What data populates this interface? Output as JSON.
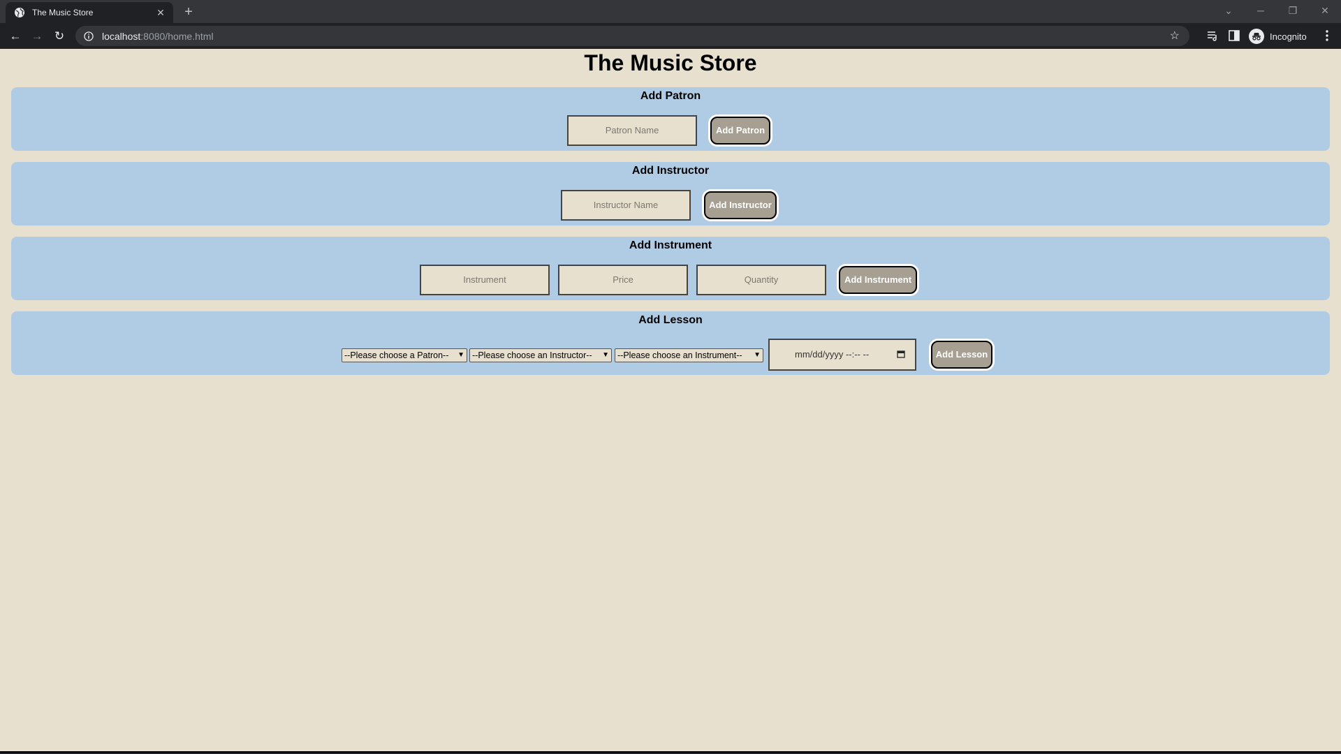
{
  "browser": {
    "tab_title": "The Music Store",
    "url_host": "localhost",
    "url_rest": ":8080/home.html",
    "profile_label": "Incognito"
  },
  "page": {
    "title": "The Music Store",
    "add_patron": {
      "heading": "Add Patron",
      "name_placeholder": "Patron Name",
      "button": "Add Patron"
    },
    "add_instructor": {
      "heading": "Add Instructor",
      "name_placeholder": "Instructor Name",
      "button": "Add Instructor"
    },
    "add_instrument": {
      "heading": "Add Instrument",
      "instrument_placeholder": "Instrument",
      "price_placeholder": "Price",
      "quantity_placeholder": "Quantity",
      "button": "Add Instrument"
    },
    "add_lesson": {
      "heading": "Add Lesson",
      "patron_select": "--Please choose a Patron--",
      "instructor_select": "--Please choose an Instructor--",
      "instrument_select": "--Please choose an Instrument--",
      "datetime_placeholder": "mm/dd/yyyy --:-- --",
      "button": "Add Lesson"
    }
  },
  "colors": {
    "page_bg": "#e8e0cf",
    "panel_bg": "#b0cce5",
    "button_bg": "#a79f91"
  }
}
